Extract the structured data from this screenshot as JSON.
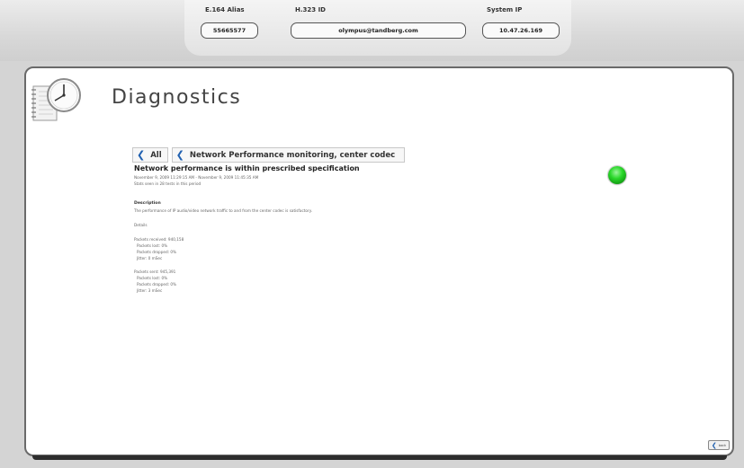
{
  "header": {
    "e164_label": "E.164 Alias",
    "e164_value": "55665577",
    "h323_label": "H.323 ID",
    "h323_value": "olympus@tandberg.com",
    "ip_label": "System IP",
    "ip_value": "10.47.26.169"
  },
  "page": {
    "title": "Diagnostics"
  },
  "breadcrumb": {
    "all_label": "All",
    "current_label": "Network Performance monitoring, center codec"
  },
  "status": {
    "title": "Network performance is within prescribed specification",
    "time_range": "November 9, 2009 11:29:15 AM - November 9, 2009 11:45:35 AM",
    "stats_note": "Stats seen in 28 tests in this period",
    "led_color": "#2ad82a"
  },
  "description": {
    "heading": "Description",
    "text": "The performance of IP audio/video network traffic to and from the center codec is satisfactory.",
    "details_label": "Details"
  },
  "received": {
    "header": "Packets received: 940,158",
    "lost": "Packets lost: 0%",
    "dropped": "Packets dropped: 0%",
    "jitter": "Jitter: 0 mSec"
  },
  "sent": {
    "header": "Packets sent: 945,391",
    "lost": "Packets lost: 0%",
    "dropped": "Packets dropped: 0%",
    "jitter": "Jitter: 3 mSec"
  },
  "footer": {
    "back_label": "back"
  },
  "icons": {
    "page_icon": "clock-notepad-icon",
    "nav": "chevron-left-icon"
  },
  "colors": {
    "accent": "#2060b0",
    "status_ok": "#2ad82a"
  }
}
